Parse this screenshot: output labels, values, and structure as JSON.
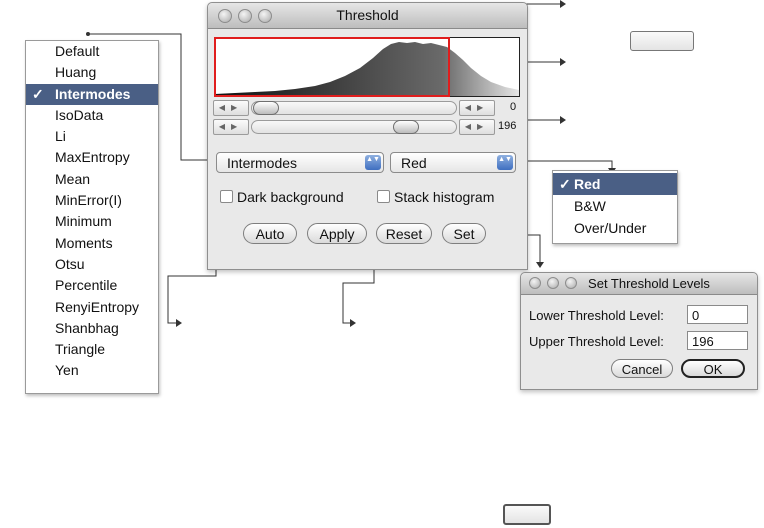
{
  "threshold_window": {
    "title": "Threshold",
    "slider_lower_value": "0",
    "slider_upper_value": "196",
    "method_popup": "Intermodes",
    "channel_popup": "Red",
    "dark_background_label": "Dark background",
    "stack_histogram_label": "Stack histogram",
    "buttons": {
      "auto": "Auto",
      "apply": "Apply",
      "reset": "Reset",
      "set": "Set"
    }
  },
  "method_list": {
    "check_mark": "✓",
    "items": [
      "Default",
      "Huang",
      "Intermodes",
      "IsoData",
      "Li",
      "MaxEntropy",
      "Mean",
      "MinError(I)",
      "Minimum",
      "Moments",
      "Otsu",
      "Percentile",
      "RenyiEntropy",
      "Shanbhag",
      "Triangle",
      "Yen"
    ],
    "selected": "Intermodes"
  },
  "channel_list": {
    "check_mark": "✓",
    "items": [
      "Red",
      "B&W",
      "Over/Under"
    ],
    "selected": "Red"
  },
  "set_levels_dialog": {
    "title": "Set Threshold Levels",
    "lower_label": "Lower Threshold Level:",
    "lower_value": "0",
    "upper_label": "Upper Threshold Level:",
    "upper_value": "196",
    "cancel": "Cancel",
    "ok": "OK"
  },
  "slider_arrows": "◀▶",
  "popup_stepper": "▲▼",
  "colors": {
    "selection": "#4a5f85",
    "threshold_red": "#e01d1d",
    "stepper_blue": "#3f6fc0"
  }
}
